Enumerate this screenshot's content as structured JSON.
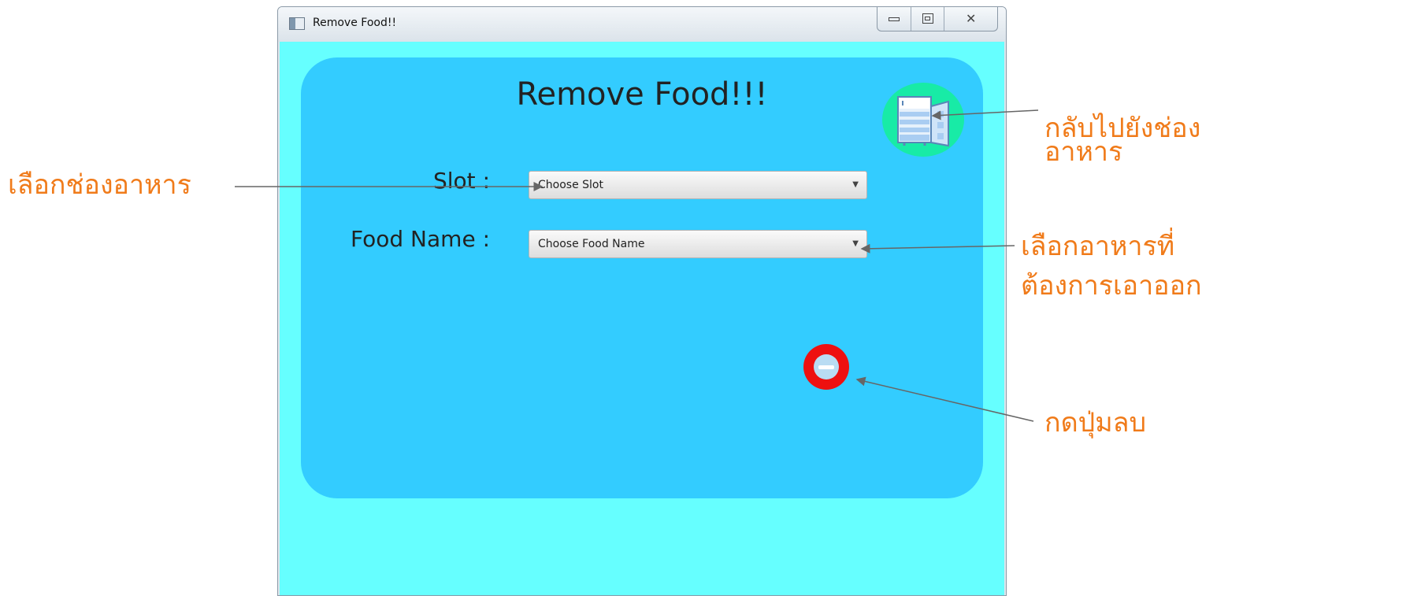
{
  "window": {
    "title": "Remove Food!!",
    "minimize_glyph": "minimize-icon",
    "maximize_glyph": "maximize-icon",
    "close_glyph": "✕"
  },
  "form": {
    "heading": "Remove Food!!!",
    "slot_label": "Slot :",
    "slot_placeholder": "Choose Slot",
    "food_label": "Food Name :",
    "food_placeholder": "Choose Food Name",
    "dropdown_arrow": "▼"
  },
  "annotations": {
    "back_line1": "กลับไปยังช่อง",
    "back_line2": "อาหาร",
    "slot": "เลือกช่องอาหาร",
    "food_line1": "เลือกอาหารที่",
    "food_line2": "ต้องการเอาออก",
    "remove": "กดปุ่มลบ"
  },
  "colors": {
    "annotation": "#f07b1a",
    "panel": "#33ccff",
    "client_background": "#66ffff",
    "fridge_button": "#18eba6",
    "remove_button": "#ee1010"
  },
  "icons": {
    "fridge_button_icon": "fridge-icon",
    "remove_button_icon": "minus-circle-icon"
  }
}
